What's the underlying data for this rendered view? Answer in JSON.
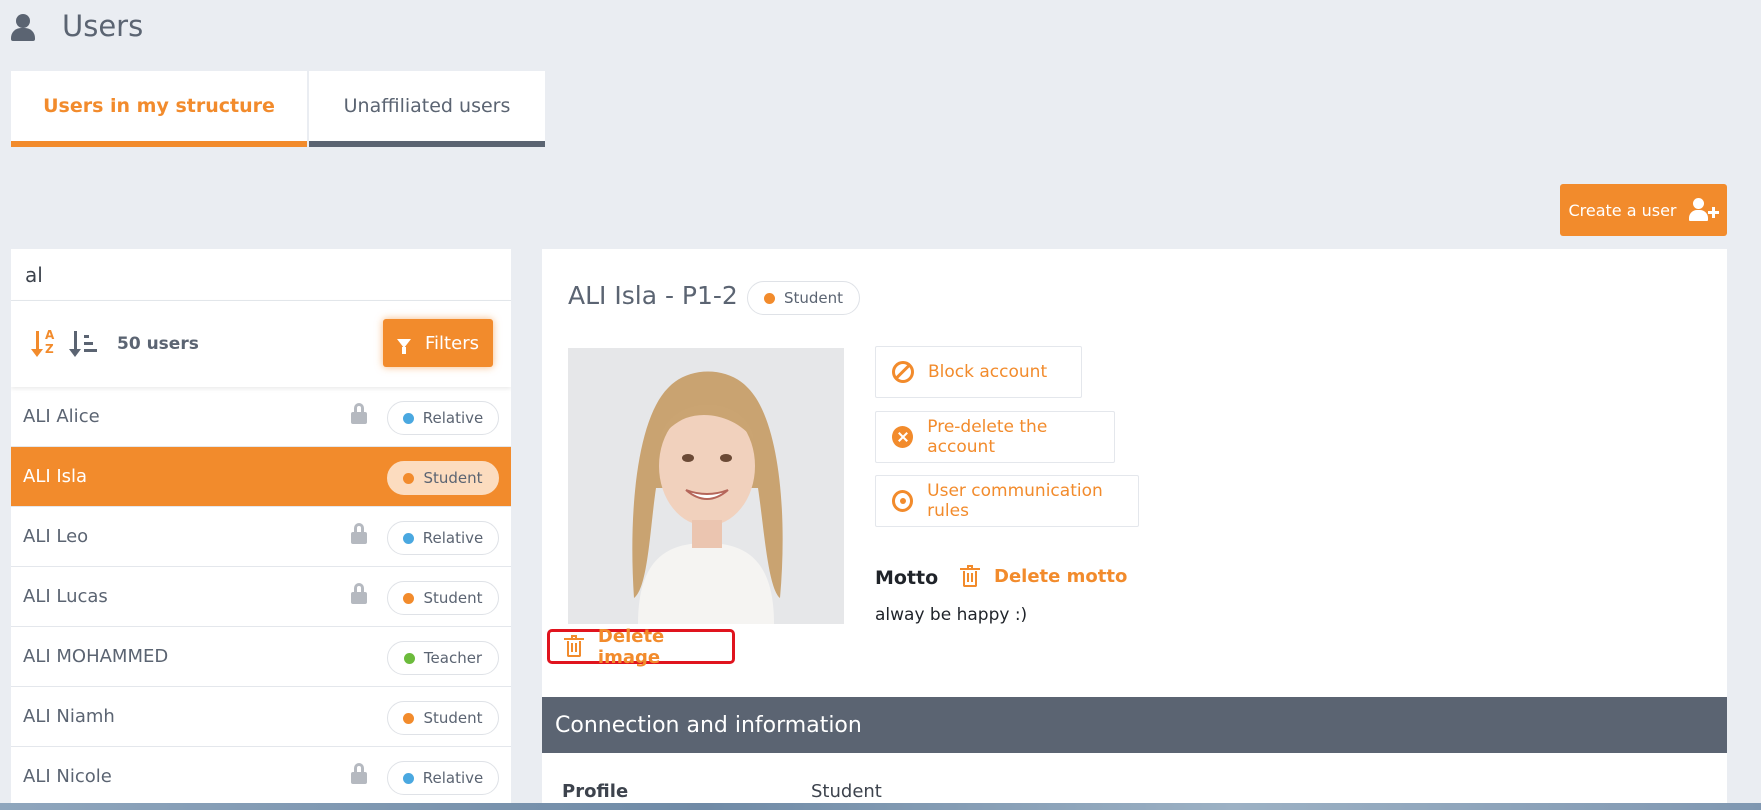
{
  "header": {
    "title": "Users",
    "icon": "user-icon"
  },
  "tabs": [
    {
      "label": "Users in my structure",
      "active": true
    },
    {
      "label": "Unaffiliated users",
      "active": false
    }
  ],
  "create_button": {
    "label": "Create a user",
    "icon": "add-user-icon"
  },
  "search": {
    "value": "al"
  },
  "list_toolbar": {
    "count_label": "50 users",
    "filters_label": "Filters"
  },
  "colors": {
    "accent": "#f28b2c",
    "relative": "#4aa8e0",
    "student": "#f28b2c",
    "teacher": "#6cbb3c",
    "dark": "#5b6472"
  },
  "users": [
    {
      "name": "ALI Alice",
      "role": "Relative",
      "locked": true,
      "selected": false
    },
    {
      "name": "ALI Isla",
      "role": "Student",
      "locked": false,
      "selected": true
    },
    {
      "name": "ALI Leo",
      "role": "Relative",
      "locked": true,
      "selected": false
    },
    {
      "name": "ALI Lucas",
      "role": "Student",
      "locked": true,
      "selected": false
    },
    {
      "name": "ALI MOHAMMED",
      "role": "Teacher",
      "locked": false,
      "selected": false
    },
    {
      "name": "ALI Niamh",
      "role": "Student",
      "locked": false,
      "selected": false
    },
    {
      "name": "ALI Nicole",
      "role": "Relative",
      "locked": true,
      "selected": false
    }
  ],
  "detail": {
    "name": "ALI Isla - P1-2",
    "role": "Student",
    "actions": {
      "block": "Block account",
      "predelete": "Pre-delete the account",
      "comm_rules": "User communication rules"
    },
    "motto_label": "Motto",
    "delete_motto_label": "Delete motto",
    "motto_text": "alway be happy :)",
    "delete_image_label": "Delete image",
    "section_title": "Connection and information",
    "profile_label": "Profile",
    "profile_value": "Student"
  }
}
